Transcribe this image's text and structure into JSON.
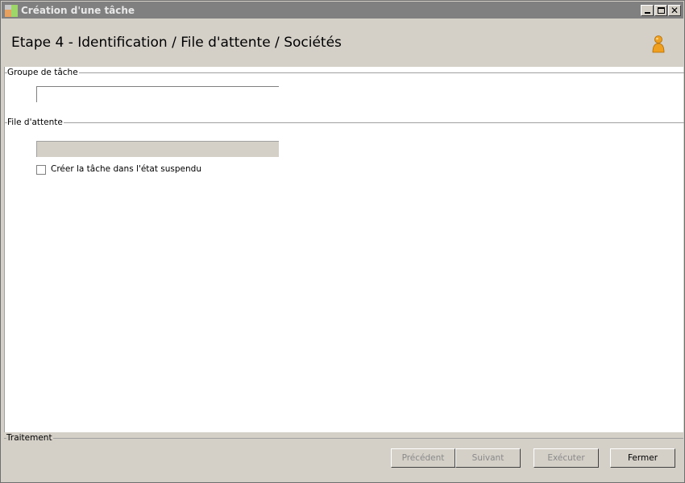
{
  "window": {
    "title": "Création d'une tâche"
  },
  "header": {
    "step_title": "Etape 4 - Identification / File d'attente / Sociétés",
    "icon": "user-icon"
  },
  "groups": {
    "task_group": {
      "label": "Groupe de tâche",
      "value": ""
    },
    "queue": {
      "label": "File d'attente",
      "value": ""
    },
    "suspend_checkbox": {
      "label": "Créer la tâche dans l'état suspendu",
      "checked": false
    }
  },
  "footer": {
    "label": "Traitement",
    "buttons": {
      "previous": "Précédent",
      "next": "Suivant",
      "execute": "Exécuter",
      "close": "Fermer"
    }
  },
  "colors": {
    "chrome": "#d4d0c8",
    "titlebar": "#808080",
    "user_icon": "#f0a020"
  }
}
